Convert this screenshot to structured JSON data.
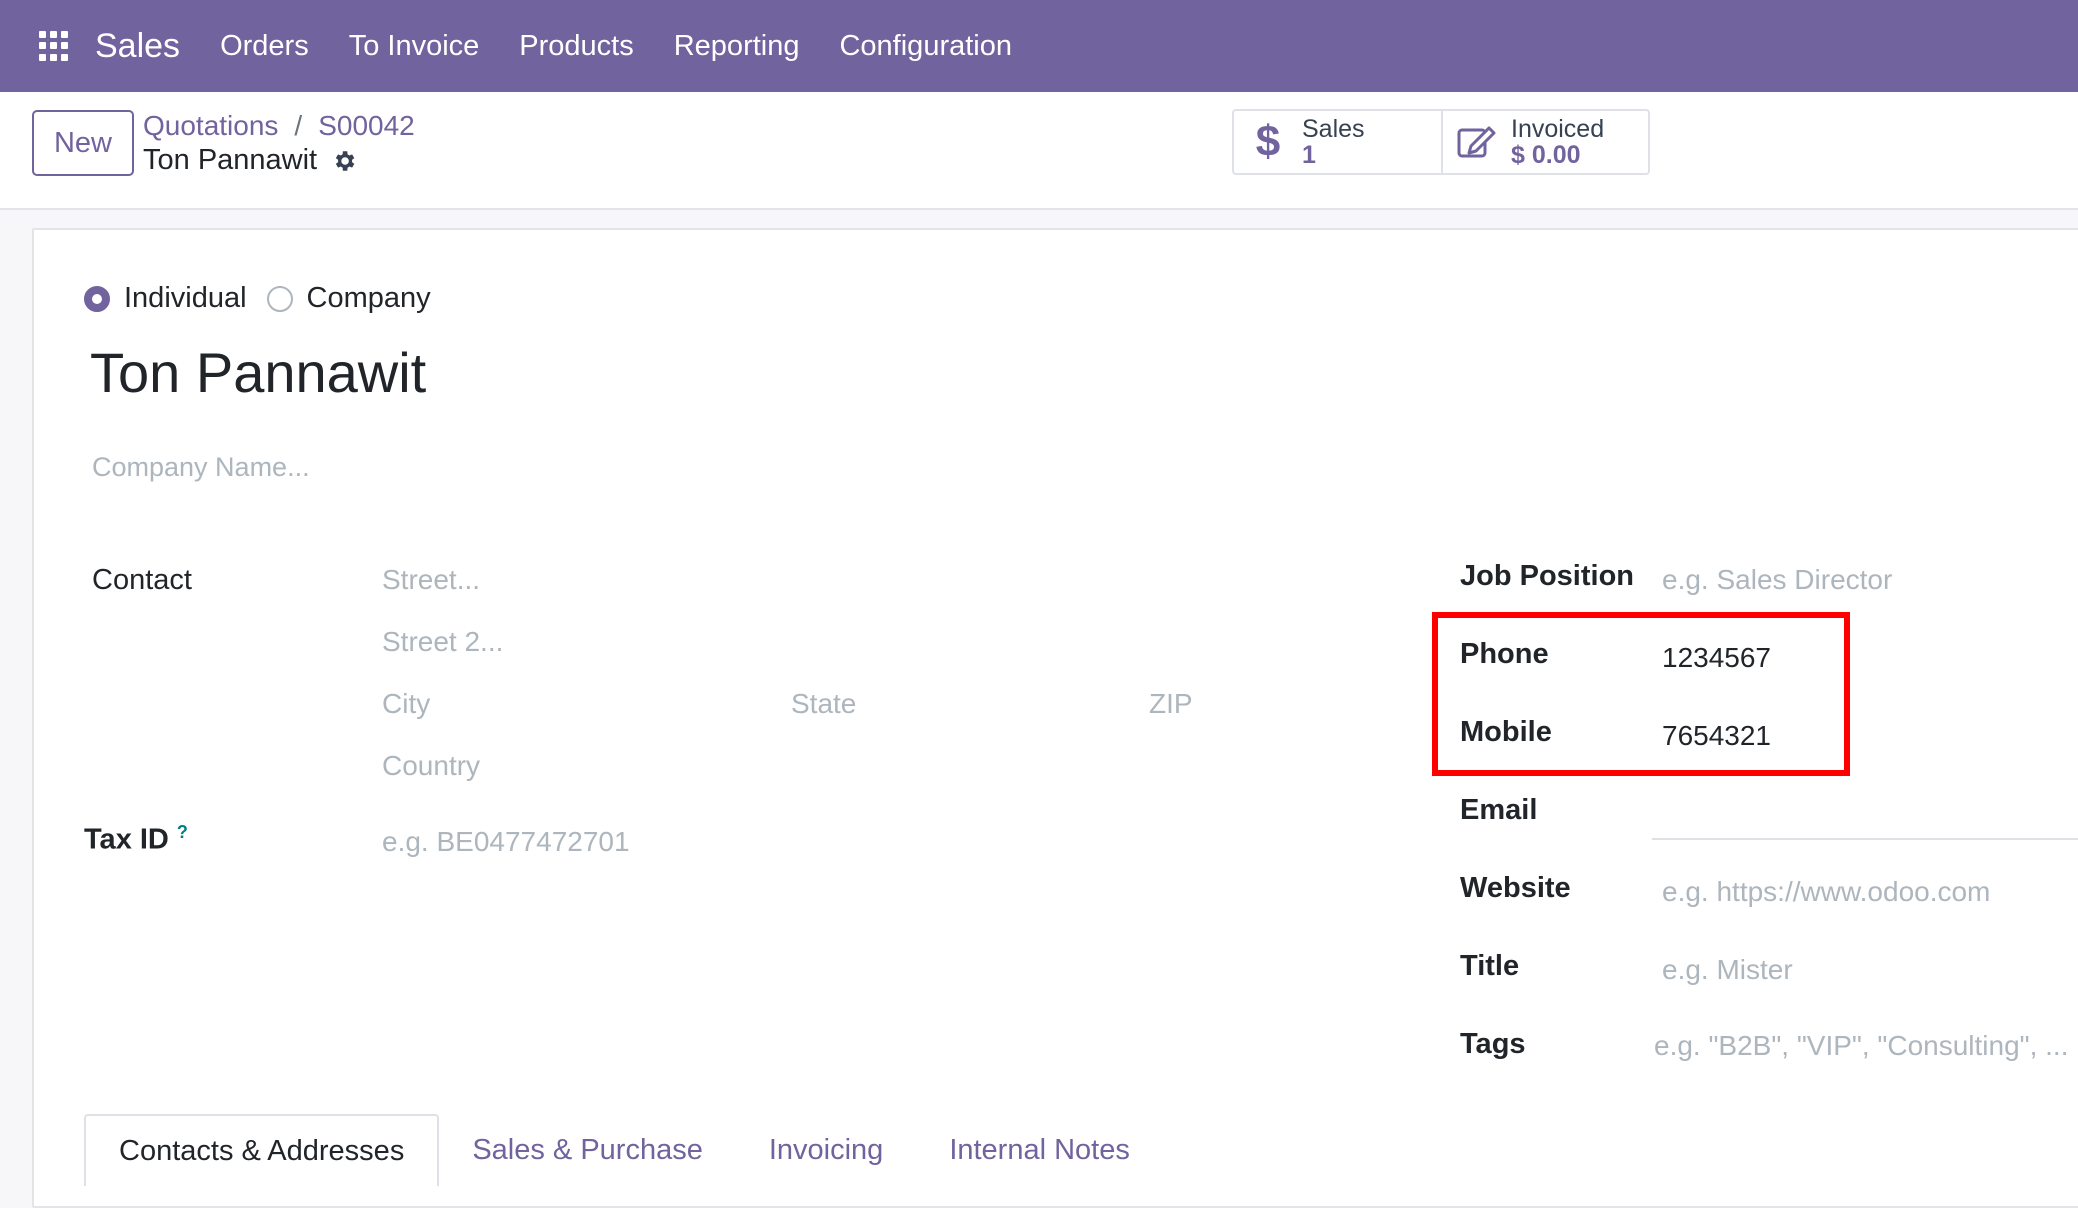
{
  "navbar": {
    "app_name": "Sales",
    "menu": [
      "Orders",
      "To Invoice",
      "Products",
      "Reporting",
      "Configuration"
    ],
    "color": "#71639e"
  },
  "control_panel": {
    "new_label": "New",
    "breadcrumb": [
      "Quotations",
      "S00042"
    ],
    "record_name": "Ton Pannawit",
    "stats": {
      "sales": {
        "label": "Sales",
        "value": "1",
        "icon": "dollar-icon"
      },
      "invoiced": {
        "label": "Invoiced",
        "value": "$ 0.00",
        "icon": "edit-icon"
      }
    }
  },
  "form": {
    "type_options": {
      "individual": "Individual",
      "company": "Company",
      "selected": "Individual"
    },
    "name": "Ton Pannawit",
    "company_name_placeholder": "Company Name...",
    "contact": {
      "label": "Contact",
      "street_placeholder": "Street...",
      "street2_placeholder": "Street 2...",
      "city_placeholder": "City",
      "state_placeholder": "State",
      "zip_placeholder": "ZIP",
      "country_placeholder": "Country"
    },
    "tax_id": {
      "label": "Tax ID",
      "help": "?",
      "placeholder": "e.g. BE0477472701"
    },
    "job_position": {
      "label": "Job Position",
      "placeholder": "e.g. Sales Director"
    },
    "phone": {
      "label": "Phone",
      "value": "1234567"
    },
    "mobile": {
      "label": "Mobile",
      "value": "7654321"
    },
    "email": {
      "label": "Email",
      "value": ""
    },
    "website": {
      "label": "Website",
      "placeholder": "e.g. https://www.odoo.com"
    },
    "title": {
      "label": "Title",
      "placeholder": "e.g. Mister"
    },
    "tags": {
      "label": "Tags",
      "placeholder": "e.g. \"B2B\", \"VIP\", \"Consulting\", ..."
    }
  },
  "tabs": [
    "Contacts & Addresses",
    "Sales & Purchase",
    "Invoicing",
    "Internal Notes"
  ],
  "highlight_color": "#ff0000"
}
